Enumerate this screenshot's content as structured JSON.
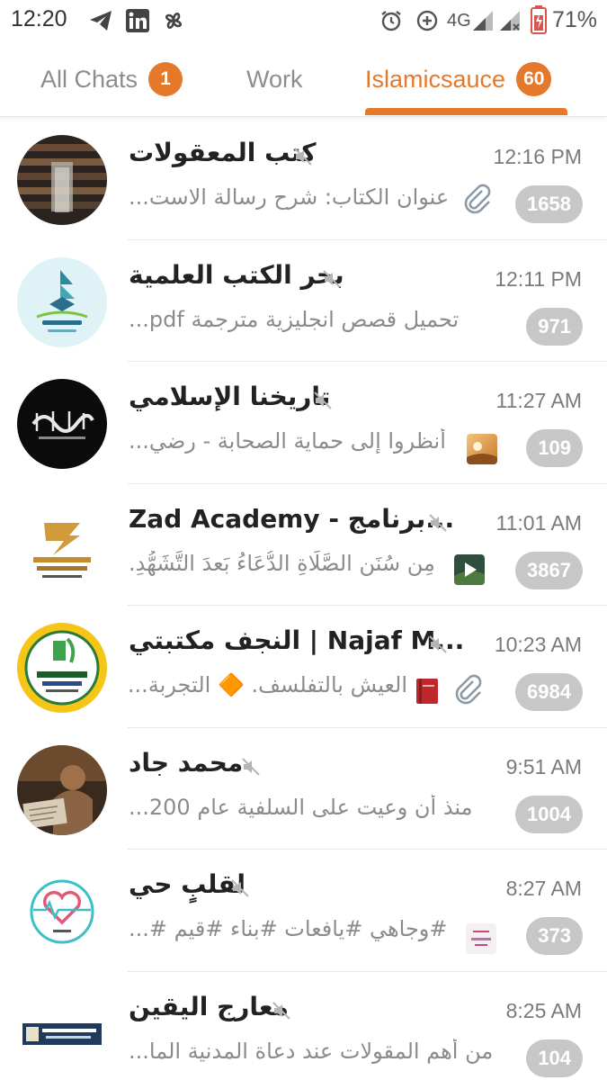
{
  "status_bar": {
    "time": "12:20",
    "network": "4G",
    "battery": "71%",
    "left_icons": [
      "telegram-icon",
      "linkedin-icon",
      "pinwheel-icon"
    ],
    "right_icons": [
      "alarm-icon",
      "data-saver-icon",
      "signal-icon",
      "signal-no-sim-icon",
      "battery-icon"
    ]
  },
  "tabs": [
    {
      "label": "All Chats",
      "badge": "1",
      "active": false
    },
    {
      "label": "Work",
      "badge": "",
      "active": false
    },
    {
      "label": "Islamicsauce",
      "badge": "60",
      "active": true
    }
  ],
  "colors": {
    "accent": "#e4792c",
    "badge_muted": "#c7c7c7",
    "title": "#222222",
    "preview": "#8b8b8b"
  },
  "chats": [
    {
      "title": "كتب المعقولات",
      "time": "12:16 PM",
      "preview": "عنوان الكتاب: شرح رسالة الاست...",
      "unread": "1658",
      "muted": true,
      "attachment": "clip"
    },
    {
      "title": "بحر الكتب العلمية",
      "time": "12:11 PM",
      "preview": "تحميل قصص انجليزية مترجمة pdf...",
      "unread": "971",
      "muted": true,
      "attachment": ""
    },
    {
      "title": "تاريخنا الإسلامي",
      "time": "11:27 AM",
      "preview": "أنظروا إلى حماية الصحابة - رضي...",
      "unread": "109",
      "muted": true,
      "attachment": "image"
    },
    {
      "title": "Zad Academy - برنامج...",
      "time": "11:01 AM",
      "preview": "مِن سُنَنِ الصَّلَاةِ الدُّعَاءُ بَعدَ التَّشَهُّدِ.",
      "unread": "3867",
      "muted": true,
      "attachment": "video"
    },
    {
      "title": "النجف مكتبتي | Najaf M...",
      "time": "10:23 AM",
      "preview": "العيش بالتفلسف. 🔶 التجربة...",
      "unread": "6984",
      "muted": true,
      "attachment": "clip-book"
    },
    {
      "title": "محمد جاد",
      "time": "9:51 AM",
      "preview": "منذ أن وعيت على السلفية عام 200...",
      "unread": "1004",
      "muted": true,
      "attachment": ""
    },
    {
      "title": "لقلبٍ حي",
      "time": "8:27 AM",
      "preview": "#وجاهي #يافعات #بناء #قيم #...",
      "unread": "373",
      "muted": true,
      "attachment": "image"
    },
    {
      "title": "معارج اليقين",
      "time": "8:25 AM",
      "preview": "من أهم المقولات عند دعاة المدنية الما...",
      "unread": "104",
      "muted": true,
      "attachment": ""
    }
  ]
}
